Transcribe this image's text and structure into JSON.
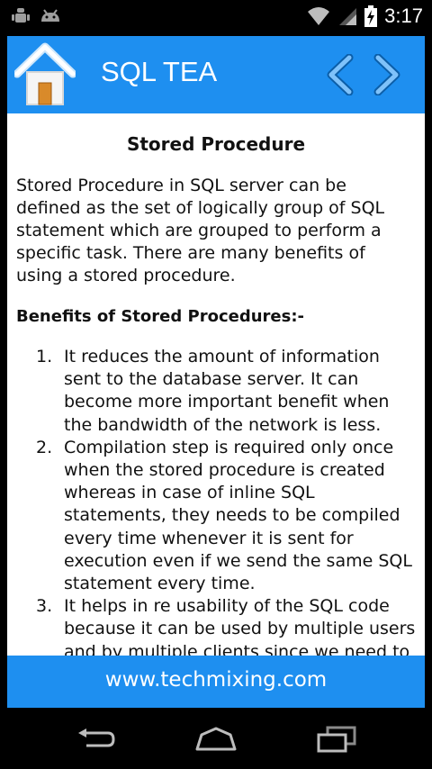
{
  "status_bar": {
    "time": "3:17",
    "icons": [
      "android-debug-icon",
      "android-icon",
      "wifi-icon",
      "signal-icon",
      "battery-charging-icon"
    ]
  },
  "header": {
    "title": "SQL TEA",
    "icons": [
      "home-icon",
      "chevron-left-icon",
      "chevron-right-icon"
    ],
    "accent_color": "#1e8ff0"
  },
  "content": {
    "title": "Stored Procedure",
    "intro": "Stored Procedure in SQL server can be defined as the set of logically group of SQL statement which are grouped to perform a specific task. There are many benefits of using a stored procedure.",
    "benefits_heading": "Benefits of Stored Procedures:-",
    "benefits": [
      {
        "num": "1.",
        "text": "It reduces the amount of information sent to the database server. It can become more important benefit when the bandwidth of the network is less."
      },
      {
        "num": "2.",
        "text": "Compilation step is required only once when the stored procedure is created whereas in case of inline SQL statements, they needs to be compiled every time whenever it is sent for execution even if we send the same SQL statement every time."
      },
      {
        "num": "3.",
        "text": "It helps in re usability of the SQL code because it can be used by multiple users and by multiple clients since we need to just call the stored procedure instead of writing the same SQL statement every time."
      }
    ]
  },
  "footer": {
    "url": "www.techmixing.com"
  },
  "nav_bar": {
    "icons": [
      "back-icon",
      "home-outline-icon",
      "recent-apps-icon"
    ]
  }
}
